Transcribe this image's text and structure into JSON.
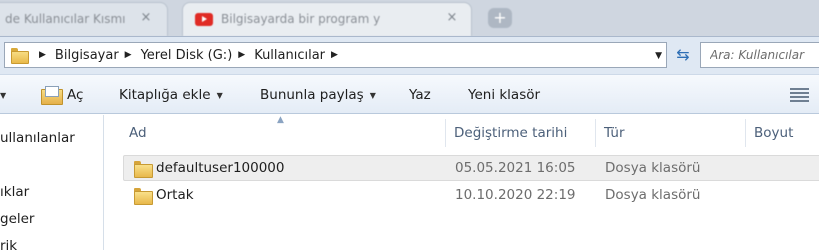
{
  "browser": {
    "tabs": [
      {
        "label": "de Kullanıcılar Kısmı",
        "close": "×"
      },
      {
        "label": "Bilgisayarda bir program y",
        "close": "×"
      }
    ],
    "new_tab": "+"
  },
  "address": {
    "crumbs": [
      "Bilgisayar",
      "Yerel Disk (G:)",
      "Kullanıcılar"
    ],
    "search_placeholder": "Ara: Kullanıcılar"
  },
  "commands": {
    "open": "Aç",
    "include_in_library": "Kitaplığa ekle",
    "share_with": "Bununla paylaş",
    "burn": "Yaz",
    "new_folder": "Yeni klasör"
  },
  "nav": {
    "items": [
      "ullanılanlar",
      "ıklar",
      "geler",
      "rik"
    ]
  },
  "columns": {
    "name": "Ad",
    "date_modified": "Değiştirme tarihi",
    "type": "Tür",
    "size": "Boyut"
  },
  "files": [
    {
      "name": "defaultuser100000",
      "date": "05.05.2021 16:05",
      "type": "Dosya klasörü",
      "selected": true
    },
    {
      "name": "Ortak",
      "date": "10.10.2020 22:19",
      "type": "Dosya klasörü",
      "selected": false
    }
  ]
}
